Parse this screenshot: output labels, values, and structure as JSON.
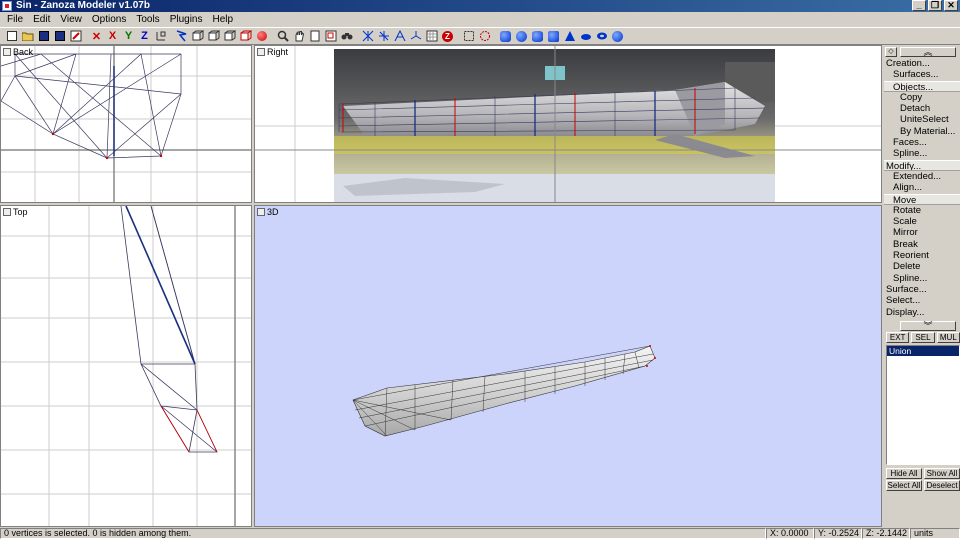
{
  "window": {
    "title": "Sin - Zanoza Modeler v1.07b",
    "buttons": [
      "_",
      "❐",
      "✕"
    ]
  },
  "menu": [
    "File",
    "Edit",
    "View",
    "Options",
    "Tools",
    "Plugins",
    "Help"
  ],
  "toolbar": {
    "axis_x": "X",
    "axis_y": "Y",
    "axis_z": "Z",
    "z_badge": "Z",
    "colors": {
      "x": "#cc0000",
      "y": "#007700",
      "z": "#0000cc",
      "sphere": "#dd1111",
      "primitive": "#0033cc"
    }
  },
  "viewports": {
    "back": {
      "label": "Back"
    },
    "right": {
      "label": "Right"
    },
    "top": {
      "label": "Top"
    },
    "persp": {
      "label": "3D"
    }
  },
  "panel": {
    "commands": [
      {
        "label": "Creation...",
        "level": 0
      },
      {
        "label": "Surfaces...",
        "level": 1
      },
      {
        "label": "Objects...",
        "level": 1,
        "highlight": true
      },
      {
        "label": "Copy",
        "level": 2
      },
      {
        "label": "Detach",
        "level": 2
      },
      {
        "label": "UniteSelect",
        "level": 2
      },
      {
        "label": "By Material...",
        "level": 2
      },
      {
        "label": "Faces...",
        "level": 1
      },
      {
        "label": "Spline...",
        "level": 1
      },
      {
        "label": "Modify...",
        "level": 0,
        "highlight": true
      },
      {
        "label": "Extended...",
        "level": 1
      },
      {
        "label": "Align...",
        "level": 1
      },
      {
        "label": "Move",
        "level": 1,
        "highlight": true
      },
      {
        "label": "Rotate",
        "level": 1
      },
      {
        "label": "Scale",
        "level": 1
      },
      {
        "label": "Mirror",
        "level": 1
      },
      {
        "label": "Break",
        "level": 1
      },
      {
        "label": "Reorient",
        "level": 1
      },
      {
        "label": "Delete",
        "level": 1
      },
      {
        "label": "Spline...",
        "level": 1
      },
      {
        "label": "Surface...",
        "level": 0
      },
      {
        "label": "Select...",
        "level": 0
      },
      {
        "label": "Display...",
        "level": 0
      }
    ],
    "mode_buttons": [
      "EXT",
      "SEL",
      "MUL"
    ],
    "objects": [
      "Union"
    ],
    "hide_all": "Hide All",
    "show_all": "Show All",
    "select_all": "Select All",
    "deselect": "Deselect"
  },
  "status": {
    "message": "0 vertices is selected. 0 is hidden among them.",
    "x": "X: 0.0000",
    "y": "Y: -0.2524",
    "z": "Z: -2.1442",
    "units": "units"
  }
}
